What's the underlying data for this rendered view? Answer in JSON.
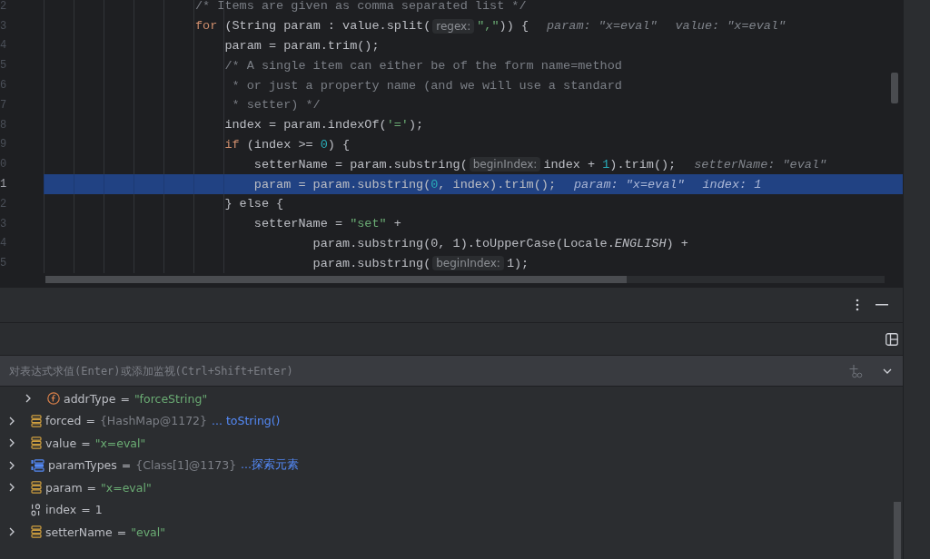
{
  "editor": {
    "lines": [
      {
        "number": "2",
        "current": false,
        "tokens": [
          {
            "kind": "comment",
            "text": "/* Items are given as comma separated list */"
          }
        ]
      },
      {
        "number": "3",
        "current": false,
        "tokens": [
          {
            "kind": "keyword",
            "text": "for"
          },
          {
            "kind": "plain",
            "text": " (String param : value.split("
          },
          {
            "kind": "hint",
            "text": "regex:"
          },
          {
            "kind": "string",
            "text": "\",\""
          },
          {
            "kind": "plain",
            "text": ")) {"
          },
          {
            "kind": "debug",
            "text": "param: \"x=eval\""
          },
          {
            "kind": "debug",
            "text": "value: \"x=eval\""
          }
        ]
      },
      {
        "number": "4",
        "current": false,
        "tokens": [
          {
            "kind": "plain",
            "text": "    param = param.trim();"
          }
        ]
      },
      {
        "number": "5",
        "current": false,
        "tokens": [
          {
            "kind": "comment",
            "text": "    /* A single item can either be of the form name=method"
          }
        ]
      },
      {
        "number": "6",
        "current": false,
        "tokens": [
          {
            "kind": "comment",
            "text": "     * or just a property name (and we will use a standard"
          }
        ]
      },
      {
        "number": "7",
        "current": false,
        "tokens": [
          {
            "kind": "comment",
            "text": "     * setter) */"
          }
        ]
      },
      {
        "number": "8",
        "current": false,
        "tokens": [
          {
            "kind": "plain",
            "text": "    index = param.indexOf("
          },
          {
            "kind": "string",
            "text": "'='"
          },
          {
            "kind": "plain",
            "text": ");"
          }
        ]
      },
      {
        "number": "9",
        "current": false,
        "tokens": [
          {
            "kind": "keyword",
            "text": "    if"
          },
          {
            "kind": "plain",
            "text": " (index >= "
          },
          {
            "kind": "number",
            "text": "0"
          },
          {
            "kind": "plain",
            "text": ") {"
          }
        ]
      },
      {
        "number": "0",
        "current": false,
        "tokens": [
          {
            "kind": "plain",
            "text": "        setterName = param.substring("
          },
          {
            "kind": "hint",
            "text": "beginIndex:"
          },
          {
            "kind": "plain",
            "text": "index + "
          },
          {
            "kind": "number",
            "text": "1"
          },
          {
            "kind": "plain",
            "text": ").trim();"
          },
          {
            "kind": "debug",
            "text": "setterName: \"eval\""
          }
        ]
      },
      {
        "number": "1",
        "current": true,
        "tokens": [
          {
            "kind": "plain",
            "text": "        param = param.substring("
          },
          {
            "kind": "number",
            "text": "0"
          },
          {
            "kind": "plain",
            "text": ", index).trim();"
          },
          {
            "kind": "debug",
            "text": "param: \"x=eval\""
          },
          {
            "kind": "debug",
            "text": "index: 1"
          }
        ]
      },
      {
        "number": "2",
        "current": false,
        "tokens": [
          {
            "kind": "plain",
            "text": "    } else {"
          }
        ]
      },
      {
        "number": "3",
        "current": false,
        "tokens": [
          {
            "kind": "plain",
            "text": "        setterName = "
          },
          {
            "kind": "string",
            "text": "\"set\""
          },
          {
            "kind": "plain",
            "text": " +"
          }
        ]
      },
      {
        "number": "4",
        "current": false,
        "tokens": [
          {
            "kind": "plain",
            "text": "                param.substring(0, 1).toUpperCase(Locale."
          },
          {
            "kind": "italic",
            "text": "ENGLISH"
          },
          {
            "kind": "plain",
            "text": ") +"
          }
        ]
      },
      {
        "number": "5",
        "current": false,
        "tokens": [
          {
            "kind": "plain",
            "text": "                param.substring("
          },
          {
            "kind": "hint",
            "text": "beginIndex:"
          },
          {
            "kind": "plain",
            "text": "1);"
          }
        ]
      }
    ]
  },
  "debug_panel": {
    "evaluate_field": {
      "placeholder": "对表达式求值(Enter)或添加监视(Ctrl+Shift+Enter)"
    },
    "variables": [
      {
        "children": [
          {
            "kind": "field",
            "expandable": true,
            "name": "addrType",
            "separator": "=",
            "value": "\"forceString\"",
            "color": "#6aab73"
          }
        ]
      },
      {
        "kind": "object",
        "expandable": true,
        "name": "forced",
        "separator": "=",
        "value": "{HashMap@1172}",
        "color": "#7c7f86",
        "link": "... toString()"
      },
      {
        "kind": "object",
        "expandable": true,
        "name": "value",
        "separator": "=",
        "value": "\"x=eval\"",
        "color": "#6aab73"
      },
      {
        "kind": "array",
        "expandable": true,
        "name": "paramTypes",
        "separator": "=",
        "value": "{Class[1]@1173}",
        "color": "#7c7f86",
        "link": "...探索元素"
      },
      {
        "kind": "object",
        "expandable": true,
        "name": "param",
        "separator": "=",
        "value": "\"x=eval\"",
        "color": "#6aab73"
      },
      {
        "kind": "primitive",
        "expandable": false,
        "name": "index",
        "separator": "=",
        "value": "1",
        "color": "#bcbec4"
      },
      {
        "kind": "object",
        "expandable": true,
        "name": "setterName",
        "separator": "=",
        "value": "\"eval\"",
        "color": "#6aab73"
      }
    ]
  }
}
